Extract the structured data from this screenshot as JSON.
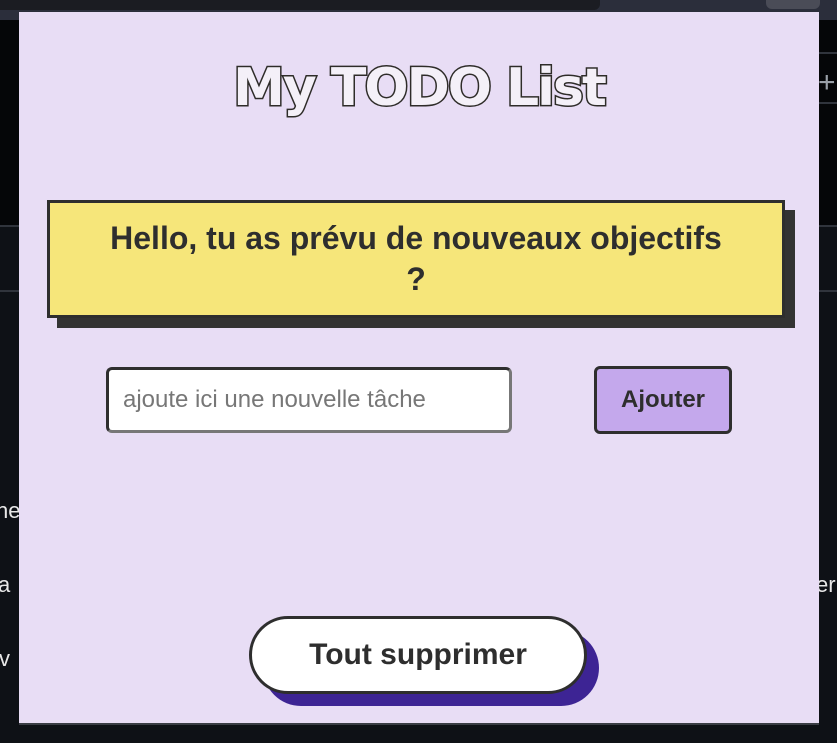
{
  "background": {
    "fragments": [
      "he",
      "a",
      "v",
      "er"
    ],
    "plus_icon": "+"
  },
  "popup": {
    "title": "My TODO List",
    "greeting": "Hello, tu as prévu de nouveaux objectifs ?",
    "task_input": {
      "value": "",
      "placeholder": "ajoute ici une nouvelle tâche"
    },
    "add_label": "Ajouter",
    "clear_all_label": "Tout supprimer"
  },
  "colors": {
    "popup_bg": "#e8ddf5",
    "greeting_bg": "#f6e67a",
    "add_button_bg": "#c4a8ec",
    "clear_shadow": "#3d2494"
  }
}
